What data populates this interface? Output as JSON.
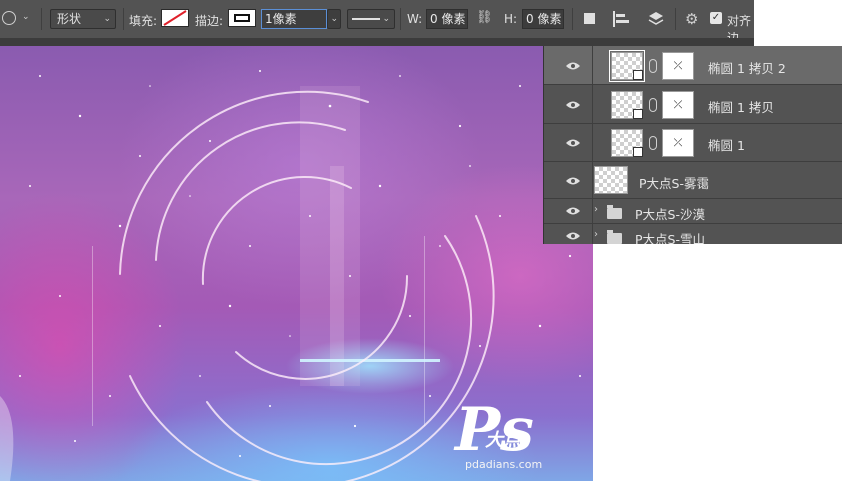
{
  "options_bar": {
    "mode_select": "形状",
    "fill_label": "填充:",
    "stroke_label": "描边:",
    "stroke_width": "1像素",
    "width_label": "W:",
    "width_value": "0 像素",
    "height_label": "H:",
    "height_value": "0 像素",
    "align_label": "对齐边",
    "icons": [
      "ellipse-tool-icon",
      "no-fill-swatch",
      "stroke-swatch",
      "stroke-style",
      "link-wh-icon",
      "path-operations-icon",
      "path-alignment-icon",
      "path-arrangement-icon",
      "gear-icon",
      "align-edges-checkbox"
    ]
  },
  "canvas": {
    "logo_text": "Ps",
    "logo_sub": "大点",
    "logo_url": "pdadians.com"
  },
  "layers": [
    {
      "name": "椭圆 1 拷贝 2",
      "type": "shape",
      "selected": true
    },
    {
      "name": "椭圆 1 拷贝",
      "type": "shape",
      "selected": false
    },
    {
      "name": "椭圆 1",
      "type": "shape",
      "selected": false
    },
    {
      "name": "P大点S-雾霭",
      "type": "pixel",
      "selected": false
    },
    {
      "name": "P大点S-沙漠",
      "type": "group",
      "selected": false
    },
    {
      "name": "P大点S-雪山",
      "type": "group",
      "selected": false
    }
  ]
}
